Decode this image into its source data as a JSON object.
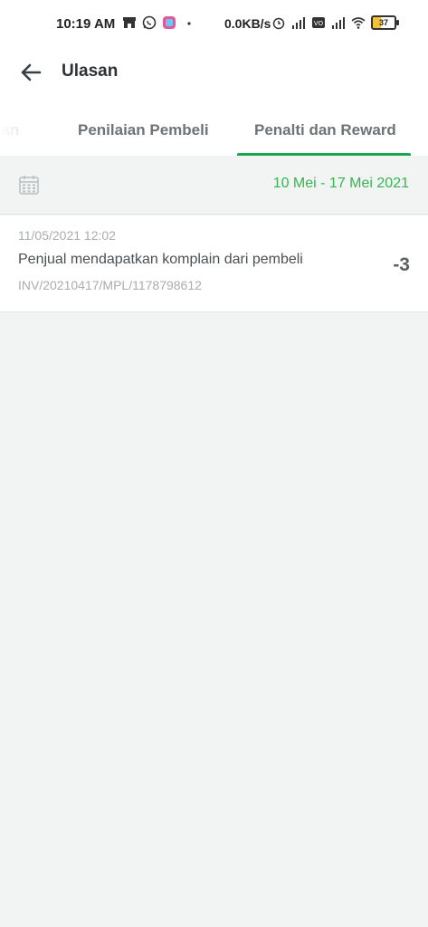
{
  "status_bar": {
    "time": "10:19 AM",
    "net_speed": "0.0KB/s",
    "battery": "37"
  },
  "header": {
    "title": "Ulasan",
    "back_icon": "arrow-left-icon"
  },
  "tabs": [
    {
      "label": "san"
    },
    {
      "label": "Penilaian Pembeli"
    },
    {
      "label": "Penalti dan Reward",
      "active": true
    }
  ],
  "filter": {
    "calendar_icon": "calendar-icon",
    "date_range": "10 Mei - 17 Mei 2021"
  },
  "entries": [
    {
      "timestamp": "11/05/2021 12:02",
      "description": "Penjual mendapatkan komplain dari pembeli",
      "invoice": "INV/20210417/MPL/1178798612",
      "points": "-3"
    }
  ],
  "colors": {
    "accent": "#17a84b",
    "date_text": "#35b551",
    "background": "#f2f3f3"
  }
}
